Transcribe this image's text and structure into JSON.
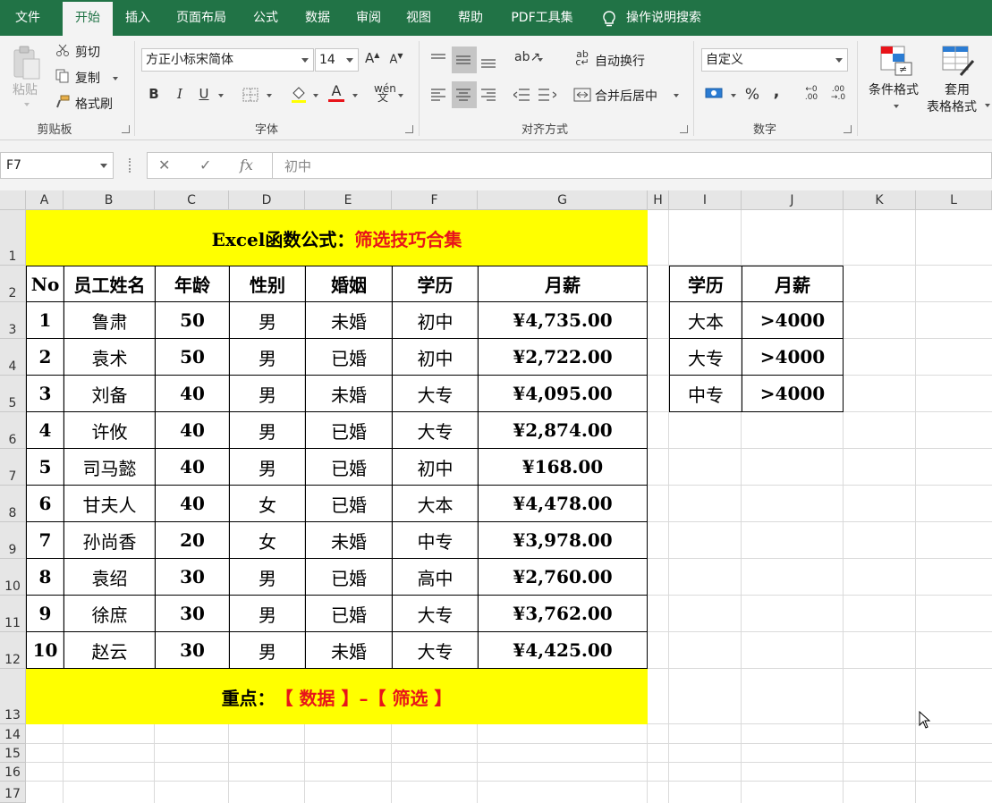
{
  "menu": {
    "items": [
      "文件",
      "开始",
      "插入",
      "页面布局",
      "公式",
      "数据",
      "审阅",
      "视图",
      "帮助",
      "PDF工具集"
    ],
    "active": "开始",
    "search": "操作说明搜索"
  },
  "ribbon": {
    "clipboard": {
      "paste": "粘贴",
      "cut": "剪切",
      "copy": "复制",
      "format_painter": "格式刷",
      "label": "剪贴板"
    },
    "font": {
      "name": "方正小标宋简体",
      "size": "14",
      "label": "字体",
      "bold": "B",
      "italic": "I",
      "underline": "U"
    },
    "alignment": {
      "wrap": "自动换行",
      "merge": "合并后居中",
      "label": "对齐方式"
    },
    "number": {
      "format": "自定义",
      "label": "数字",
      "percent": "%",
      "comma": ","
    },
    "styles": {
      "conditional": "条件格式",
      "table_1": "套用",
      "table_2": "表格格式"
    }
  },
  "formula_bar": {
    "name_box": "F7",
    "content": "初中",
    "fx": "fx"
  },
  "colors": {
    "brand": "#217346",
    "highlight": "#ffff00",
    "accent_red": "#e8141a"
  },
  "sheet": {
    "columns": [
      "A",
      "B",
      "C",
      "D",
      "E",
      "F",
      "G",
      "H",
      "I",
      "J",
      "K",
      "L"
    ],
    "rows": [
      "1",
      "2",
      "3",
      "4",
      "5",
      "6",
      "7",
      "8",
      "9",
      "10",
      "11",
      "12",
      "13",
      "14",
      "15",
      "16",
      "17"
    ],
    "title": {
      "black": "Excel函数公式：",
      "red": "筛选技巧合集"
    },
    "headers": [
      "No",
      "员工姓名",
      "年龄",
      "性别",
      "婚姻",
      "学历",
      "月薪"
    ],
    "data": [
      [
        "1",
        "鲁肃",
        "50",
        "男",
        "未婚",
        "初中",
        "¥4,735.00"
      ],
      [
        "2",
        "袁术",
        "50",
        "男",
        "已婚",
        "初中",
        "¥2,722.00"
      ],
      [
        "3",
        "刘备",
        "40",
        "男",
        "未婚",
        "大专",
        "¥4,095.00"
      ],
      [
        "4",
        "许攸",
        "40",
        "男",
        "已婚",
        "大专",
        "¥2,874.00"
      ],
      [
        "5",
        "司马懿",
        "40",
        "男",
        "已婚",
        "初中",
        "¥168.00"
      ],
      [
        "6",
        "甘夫人",
        "40",
        "女",
        "已婚",
        "大本",
        "¥4,478.00"
      ],
      [
        "7",
        "孙尚香",
        "20",
        "女",
        "未婚",
        "中专",
        "¥3,978.00"
      ],
      [
        "8",
        "袁绍",
        "30",
        "男",
        "已婚",
        "高中",
        "¥2,760.00"
      ],
      [
        "9",
        "徐庶",
        "30",
        "男",
        "已婚",
        "大专",
        "¥3,762.00"
      ],
      [
        "10",
        "赵云",
        "30",
        "男",
        "未婚",
        "大专",
        "¥4,425.00"
      ]
    ],
    "footer": {
      "black": "重点：",
      "red": "【 数据 】–【 筛选 】"
    },
    "criteria": {
      "headers": [
        "学历",
        "月薪"
      ],
      "rows": [
        [
          "大本",
          ">4000"
        ],
        [
          "大专",
          ">4000"
        ],
        [
          "中专",
          ">4000"
        ]
      ]
    }
  }
}
